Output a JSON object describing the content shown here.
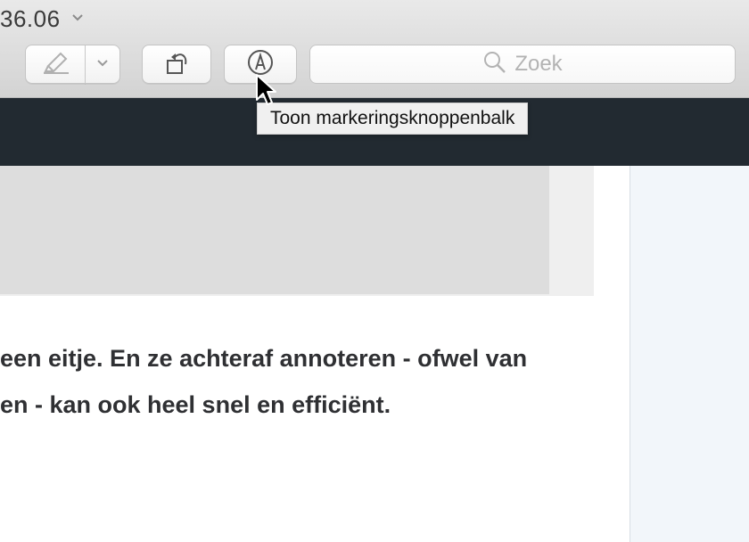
{
  "window": {
    "title": "36.06"
  },
  "toolbar": {
    "buttons": [
      {
        "name": "highlight",
        "icon": "highlighter-icon"
      },
      {
        "name": "highlight-menu",
        "icon": "chevron-down-icon"
      },
      {
        "name": "rotate",
        "icon": "rotate-left-icon"
      },
      {
        "name": "markup",
        "icon": "markup-pen-icon"
      }
    ],
    "search": {
      "placeholder": "Zoek",
      "icon": "search-icon"
    }
  },
  "tooltip": {
    "text": "Toon markeringsknoppenbalk"
  },
  "content": {
    "lines": [
      "een eitje. En ze achteraf annoteren - ofwel van",
      "en - kan ook heel snel en efficiënt."
    ]
  },
  "colors": {
    "dark_bar": "#222a31",
    "sidebar": "#f2f6fa",
    "text": "#2f3033",
    "toolbar_bg": "#dcdcdc"
  }
}
